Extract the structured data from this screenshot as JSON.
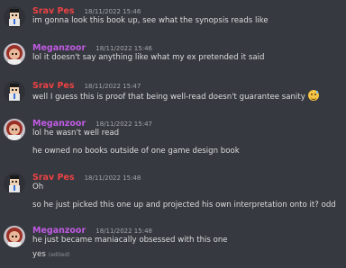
{
  "colors": {
    "srav": "#ed4245",
    "meganzoor": "#c05be3"
  },
  "messages": [
    {
      "author": "Srav Pes",
      "avatar": "srav-avatar",
      "timestamp": "18/11/2022 15:46",
      "lines": [
        "im gonna look this book up, see what the synopsis reads like"
      ]
    },
    {
      "author": "Meganzoor",
      "avatar": "meganzoor-avatar",
      "timestamp": "18/11/2022 15:46",
      "lines": [
        "lol it doesn't say anything like what my ex pretended it said"
      ]
    },
    {
      "author": "Srav Pes",
      "avatar": "srav-avatar",
      "timestamp": "18/11/2022 15:47",
      "lines": [
        "well I guess this is proof that being well-read doesn't guarantee sanity"
      ],
      "emoji": "sweat-smile-emoji"
    },
    {
      "author": "Meganzoor",
      "avatar": "meganzoor-avatar",
      "timestamp": "18/11/2022 15:47",
      "lines": [
        "lol he wasn't well read",
        "he owned no books outside of one game design book"
      ]
    },
    {
      "author": "Srav Pes",
      "avatar": "srav-avatar",
      "timestamp": "18/11/2022 15:48",
      "lines": [
        "Oh",
        "so he just picked this one up and projected his own interpretation onto it? odd"
      ]
    },
    {
      "author": "Meganzoor",
      "avatar": "meganzoor-avatar",
      "timestamp": "18/11/2022 15:48",
      "lines": [
        "he just became maniacally obsessed with this one",
        "yes"
      ],
      "edited_label": "(edited)"
    }
  ]
}
